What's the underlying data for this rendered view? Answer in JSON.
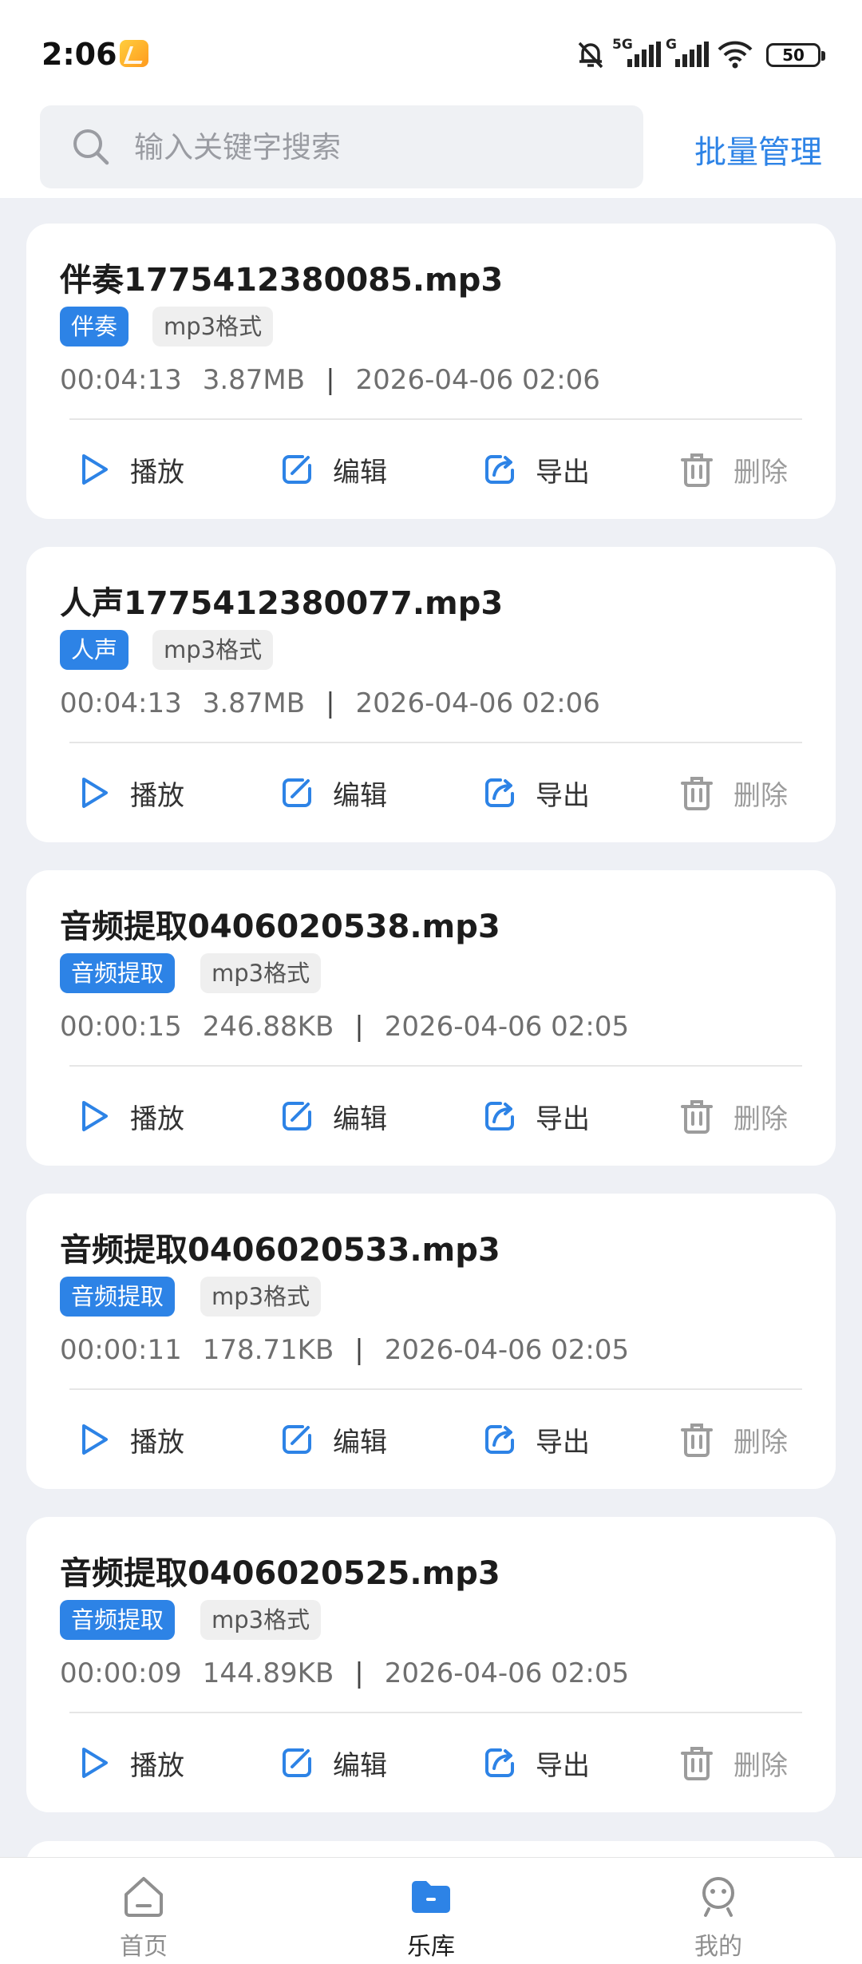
{
  "status_bar": {
    "time": "2:06",
    "battery": "50",
    "network_5g": "5G",
    "network_g": "G"
  },
  "header": {
    "search_placeholder": "输入关键字搜索",
    "batch_manage": "批量管理"
  },
  "actions": {
    "play": "播放",
    "edit": "编辑",
    "export": "导出",
    "delete": "删除"
  },
  "colors": {
    "accent": "#2d83e6",
    "background": "#eef0f5",
    "muted": "#9c9c9c"
  },
  "items": [
    {
      "title": "伴奏1775412380085.mp3",
      "tag": "伴奏",
      "format": "mp3格式",
      "duration": "00:04:13",
      "size": "3.87MB",
      "sep": "|",
      "date": "2026-04-06 02:06"
    },
    {
      "title": "人声1775412380077.mp3",
      "tag": "人声",
      "format": "mp3格式",
      "duration": "00:04:13",
      "size": "3.87MB",
      "sep": "|",
      "date": "2026-04-06 02:06"
    },
    {
      "title": "音频提取0406020538.mp3",
      "tag": "音频提取",
      "format": "mp3格式",
      "duration": "00:00:15",
      "size": "246.88KB",
      "sep": "|",
      "date": "2026-04-06 02:05"
    },
    {
      "title": "音频提取0406020533.mp3",
      "tag": "音频提取",
      "format": "mp3格式",
      "duration": "00:00:11",
      "size": "178.71KB",
      "sep": "|",
      "date": "2026-04-06 02:05"
    },
    {
      "title": "音频提取0406020525.mp3",
      "tag": "音频提取",
      "format": "mp3格式",
      "duration": "00:00:09",
      "size": "144.89KB",
      "sep": "|",
      "date": "2026-04-06 02:05"
    }
  ],
  "bottom_nav": {
    "items": [
      {
        "label": "首页",
        "icon": "home-icon",
        "active": false
      },
      {
        "label": "乐库",
        "icon": "folder-icon",
        "active": true
      },
      {
        "label": "我的",
        "icon": "profile-icon",
        "active": false
      }
    ]
  }
}
